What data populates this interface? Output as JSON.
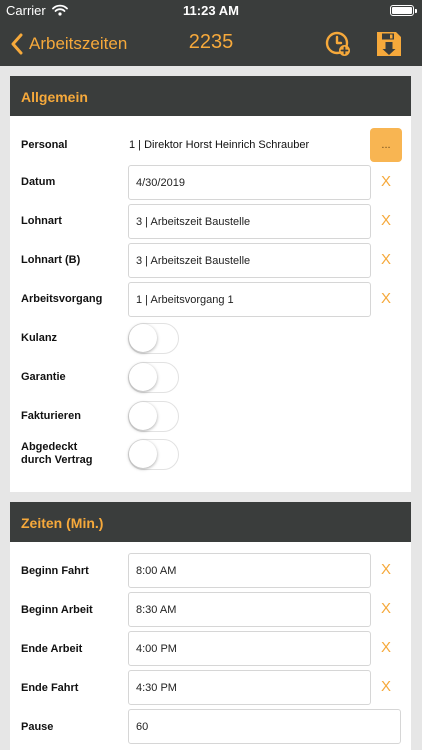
{
  "status_bar": {
    "carrier": "Carrier",
    "time": "11:23 AM"
  },
  "nav": {
    "back_label": "Arbeitszeiten",
    "title": "2235"
  },
  "sections": {
    "general": {
      "title": "Allgemein",
      "personal_label": "Personal",
      "personal_value": "1 | Direktor Horst Heinrich Schrauber",
      "picker_label": "...",
      "date_label": "Datum",
      "date_value": "4/30/2019",
      "wage_label": "Lohnart",
      "wage_value": "3 | Arbeitszeit Baustelle",
      "wage_b_label": "Lohnart (B)",
      "wage_b_value": "3 | Arbeitszeit Baustelle",
      "process_label": "Arbeitsvorgang",
      "process_value": "1 | Arbeitsvorgang 1",
      "goodwill_label": "Kulanz",
      "warranty_label": "Garantie",
      "invoice_label": "Fakturieren",
      "contract_label_line1": "Abgedeckt",
      "contract_label_line2": "durch Vertrag"
    },
    "times": {
      "title": "Zeiten (Min.)",
      "start_travel_label": "Beginn Fahrt",
      "start_travel_value": "8:00 AM",
      "start_work_label": "Beginn Arbeit",
      "start_work_value": "8:30 AM",
      "end_work_label": "Ende Arbeit",
      "end_work_value": "4:00 PM",
      "end_travel_label": "Ende Fahrt",
      "end_travel_value": "4:30 PM",
      "break_label": "Pause",
      "break_value": "60"
    }
  },
  "clear_symbol": "X",
  "toggles": {
    "goodwill": false,
    "warranty": false,
    "invoice": false,
    "contract": false
  },
  "colors": {
    "accent": "#f6a93b",
    "header_bg": "#3a3d3c",
    "background": "#e6e6e6"
  }
}
